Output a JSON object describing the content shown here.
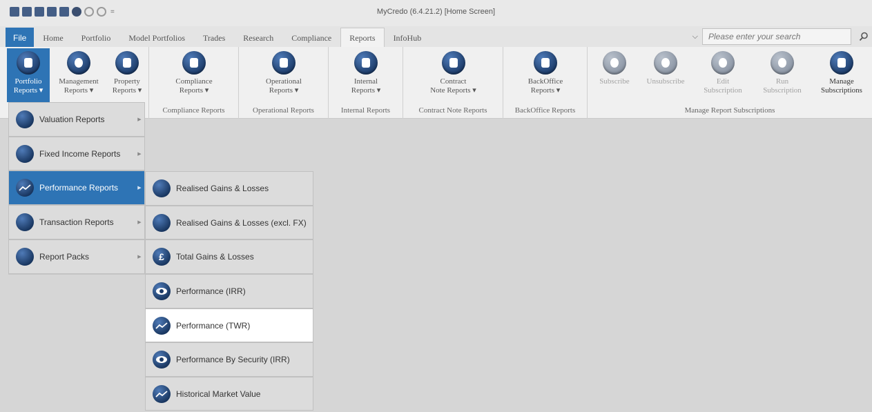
{
  "window": {
    "title": "MyCredo (6.4.21.2) [Home Screen]"
  },
  "quick_access_toolbar": {
    "icons": [
      "report-icon",
      "report-icon",
      "chart-icon",
      "send-icon",
      "print-icon",
      "close-circle-icon",
      "refresh-icon",
      "sync-icon"
    ],
    "more": "="
  },
  "menu_tabs": [
    {
      "label": "File"
    },
    {
      "label": "Home"
    },
    {
      "label": "Portfolio"
    },
    {
      "label": "Model Portfolios"
    },
    {
      "label": "Trades"
    },
    {
      "label": "Research"
    },
    {
      "label": "Compliance"
    },
    {
      "label": "Reports"
    },
    {
      "label": "InfoHub"
    }
  ],
  "active_tab": "Reports",
  "search": {
    "placeholder": "Please enter your search"
  },
  "ribbon": {
    "buttons": {
      "portfolio_reports": "Portfolio\nReports ▾",
      "management_reports": "Management\nReports ▾",
      "property_reports": "Property\nReports ▾",
      "compliance_reports": "Compliance\nReports ▾",
      "operational_reports": "Operational\nReports ▾",
      "internal_reports": "Internal\nReports ▾",
      "contract_note_reports": "Contract\nNote Reports ▾",
      "backoffice_reports": "BackOffice\nReports ▾",
      "subscribe": "Subscribe",
      "unsubscribe": "Unsubscribe",
      "edit_subscription": "Edit\nSubscription",
      "run_subscription": "Run\nSubscription",
      "manage_subscriptions": "Manage\nSubscriptions"
    },
    "group_labels": {
      "compliance": "Compliance Reports",
      "operational": "Operational Reports",
      "internal": "Internal Reports",
      "contract_note": "Contract Note Reports",
      "backoffice": "BackOffice Reports",
      "subscriptions": "Manage Report Subscriptions"
    }
  },
  "dropdown": {
    "items": [
      {
        "label": "Valuation Reports",
        "icon": "briefcase-icon"
      },
      {
        "label": "Fixed Income Reports",
        "icon": "briefcase-icon"
      },
      {
        "label": "Performance Reports",
        "icon": "performance-chart-icon"
      },
      {
        "label": "Transaction Reports",
        "icon": "document-icon"
      },
      {
        "label": "Report Packs",
        "icon": "briefcase-icon"
      }
    ],
    "arrow": "▶"
  },
  "submenu": {
    "items": [
      {
        "label": "Realised Gains & Losses",
        "icon": "tag-icon"
      },
      {
        "label": "Realised Gains & Losses (excl. FX)",
        "icon": "tag-icon"
      },
      {
        "label": "Total Gains & Losses",
        "icon": "pound-icon",
        "glyph": "£"
      },
      {
        "label": "Performance (IRR)",
        "icon": "eye-icon"
      },
      {
        "label": "Performance (TWR)",
        "icon": "performance-chart-icon"
      },
      {
        "label": "Performance By Security (IRR)",
        "icon": "eye-icon"
      },
      {
        "label": "Historical Market Value",
        "icon": "performance-chart-icon"
      }
    ]
  },
  "colors": {
    "accent": "#2e74b5",
    "background": "#d6d6d6",
    "ribbon": "#f0f0f0",
    "icon_blue": "#1b3a67"
  }
}
